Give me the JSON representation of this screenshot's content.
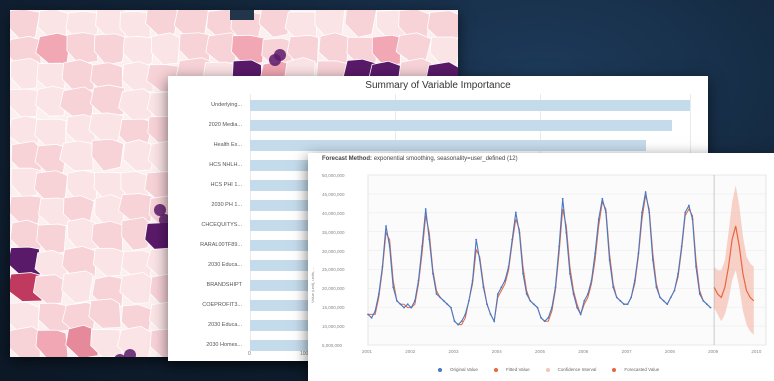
{
  "colors": {
    "map_light": "#fbe4e6",
    "map_mid": "#f2a7b4",
    "map_dark": "#c0395e",
    "map_darkest": "#5a1a6a",
    "bar": "#c4dbeb",
    "original": "#4a78c4",
    "fitted": "#e8663d",
    "confidence": "#f6c3b6",
    "forecast": "#e8663d"
  },
  "importance": {
    "title": "Summary of Variable Importance",
    "labels": [
      "Underlying...",
      "2020 Media...",
      "Health Ex...",
      "HCS NHLH...",
      "HCS PHI 1...",
      "2030 PH 1...",
      "CHCEQUITYS...",
      "RARAL00TF89...",
      "2030 Educa...",
      "BRANDSHIPT",
      "COEPROFIT3...",
      "2030 Educa...",
      "2030 Homes..."
    ],
    "values": [
      1.0,
      0.96,
      0.9,
      0.84,
      0.8,
      0.76,
      0.72,
      0.68,
      0.62,
      0.58,
      0.54,
      0.5,
      0.46
    ],
    "ticks": [
      "0",
      "100"
    ]
  },
  "forecast": {
    "header_bold": "Forecast Method:",
    "header_rest": "exponential smoothing, seasonality=user_defined (12)",
    "ylabel": "Value (unit), units, ... ",
    "yticks": [
      "50,000,000",
      "45,000,000",
      "40,000,000",
      "35,000,000",
      "30,000,000",
      "25,000,000",
      "20,000,000",
      "15,000,000",
      "10,000,000",
      "5,000,000"
    ],
    "xticks": [
      "2001",
      "2002",
      "2003",
      "2004",
      "2005",
      "2006",
      "2007",
      "2008",
      "2009",
      "2010"
    ],
    "legend": [
      "Original Value",
      "Fitted Value",
      "Confidence Interval",
      "Forecasted Value"
    ]
  },
  "chart_data": {
    "type": "line",
    "title": "",
    "xlabel": "",
    "ylabel": "",
    "x": [
      2001.0,
      2001.083,
      2001.167,
      2001.25,
      2001.333,
      2001.417,
      2001.5,
      2001.583,
      2001.667,
      2001.75,
      2001.833,
      2001.917,
      2002.0,
      2002.083,
      2002.167,
      2002.25,
      2002.333,
      2002.417,
      2002.5,
      2002.583,
      2002.667,
      2002.75,
      2002.833,
      2002.917,
      2003.0,
      2003.083,
      2003.167,
      2003.25,
      2003.333,
      2003.417,
      2003.5,
      2003.583,
      2003.667,
      2003.75,
      2003.833,
      2003.917,
      2004.0,
      2004.083,
      2004.167,
      2004.25,
      2004.333,
      2004.417,
      2004.5,
      2004.583,
      2004.667,
      2004.75,
      2004.833,
      2004.917,
      2005.0,
      2005.083,
      2005.167,
      2005.25,
      2005.333,
      2005.417,
      2005.5,
      2005.583,
      2005.667,
      2005.75,
      2005.833,
      2005.917,
      2006.0,
      2006.083,
      2006.167,
      2006.25,
      2006.333,
      2006.417,
      2006.5,
      2006.583,
      2006.667,
      2006.75,
      2006.833,
      2006.917,
      2007.0,
      2007.083,
      2007.167,
      2007.25,
      2007.333,
      2007.417,
      2007.5,
      2007.583,
      2007.667,
      2007.75,
      2007.833,
      2007.917,
      2008.0,
      2008.083,
      2008.167,
      2008.25,
      2008.333,
      2008.417,
      2008.5,
      2008.583,
      2008.667,
      2008.75,
      2008.833,
      2008.917
    ],
    "series": [
      {
        "name": "Original Value",
        "values": [
          14,
          13,
          15,
          20,
          28,
          40,
          34,
          22,
          18,
          17,
          16,
          17,
          16,
          18,
          24,
          34,
          45,
          36,
          26,
          20,
          19,
          18,
          17,
          16,
          12,
          11,
          12,
          14,
          18,
          24,
          36,
          30,
          22,
          17,
          14,
          12,
          20,
          22,
          24,
          28,
          36,
          44,
          38,
          26,
          20,
          18,
          17,
          16,
          13,
          12,
          13,
          16,
          22,
          34,
          48,
          38,
          26,
          20,
          16,
          14,
          18,
          20,
          24,
          32,
          42,
          48,
          44,
          30,
          22,
          19,
          18,
          17,
          17,
          19,
          24,
          32,
          44,
          50,
          44,
          30,
          22,
          19,
          18,
          17,
          19,
          21,
          26,
          34,
          44,
          46,
          42,
          28,
          20,
          18,
          17,
          16
        ]
      },
      {
        "name": "Fitted Value",
        "values": [
          14,
          14,
          14,
          19,
          27,
          38,
          36,
          24,
          18,
          17,
          17,
          16,
          16,
          17,
          23,
          32,
          43,
          38,
          27,
          21,
          19,
          18,
          17,
          16,
          12,
          11,
          11,
          13,
          18,
          23,
          33,
          31,
          23,
          17,
          14,
          12,
          19,
          21,
          23,
          27,
          35,
          42,
          39,
          28,
          21,
          18,
          17,
          16,
          13,
          12,
          12,
          15,
          21,
          32,
          45,
          40,
          28,
          21,
          17,
          14,
          17,
          19,
          23,
          30,
          40,
          47,
          45,
          32,
          23,
          19,
          18,
          17,
          17,
          19,
          23,
          31,
          42,
          49,
          45,
          32,
          23,
          19,
          18,
          17,
          19,
          21,
          25,
          33,
          43,
          45,
          43,
          30,
          21,
          18,
          17,
          16
        ]
      }
    ],
    "forecast_x": [
      2009.0,
      2009.083,
      2009.167,
      2009.25,
      2009.333,
      2009.417,
      2009.5,
      2009.583,
      2009.667,
      2009.75,
      2009.833,
      2009.917
    ],
    "forecast_values": [
      22,
      20,
      19,
      22,
      28,
      36,
      40,
      34,
      26,
      21,
      19,
      18
    ],
    "forecast_low": [
      16,
      14,
      12,
      14,
      18,
      24,
      27,
      22,
      15,
      11,
      9,
      8
    ],
    "forecast_high": [
      28,
      27,
      27,
      30,
      38,
      47,
      52,
      46,
      37,
      31,
      29,
      28
    ],
    "ylim": [
      5,
      55
    ],
    "grid": true,
    "legend_position": "bottom"
  }
}
